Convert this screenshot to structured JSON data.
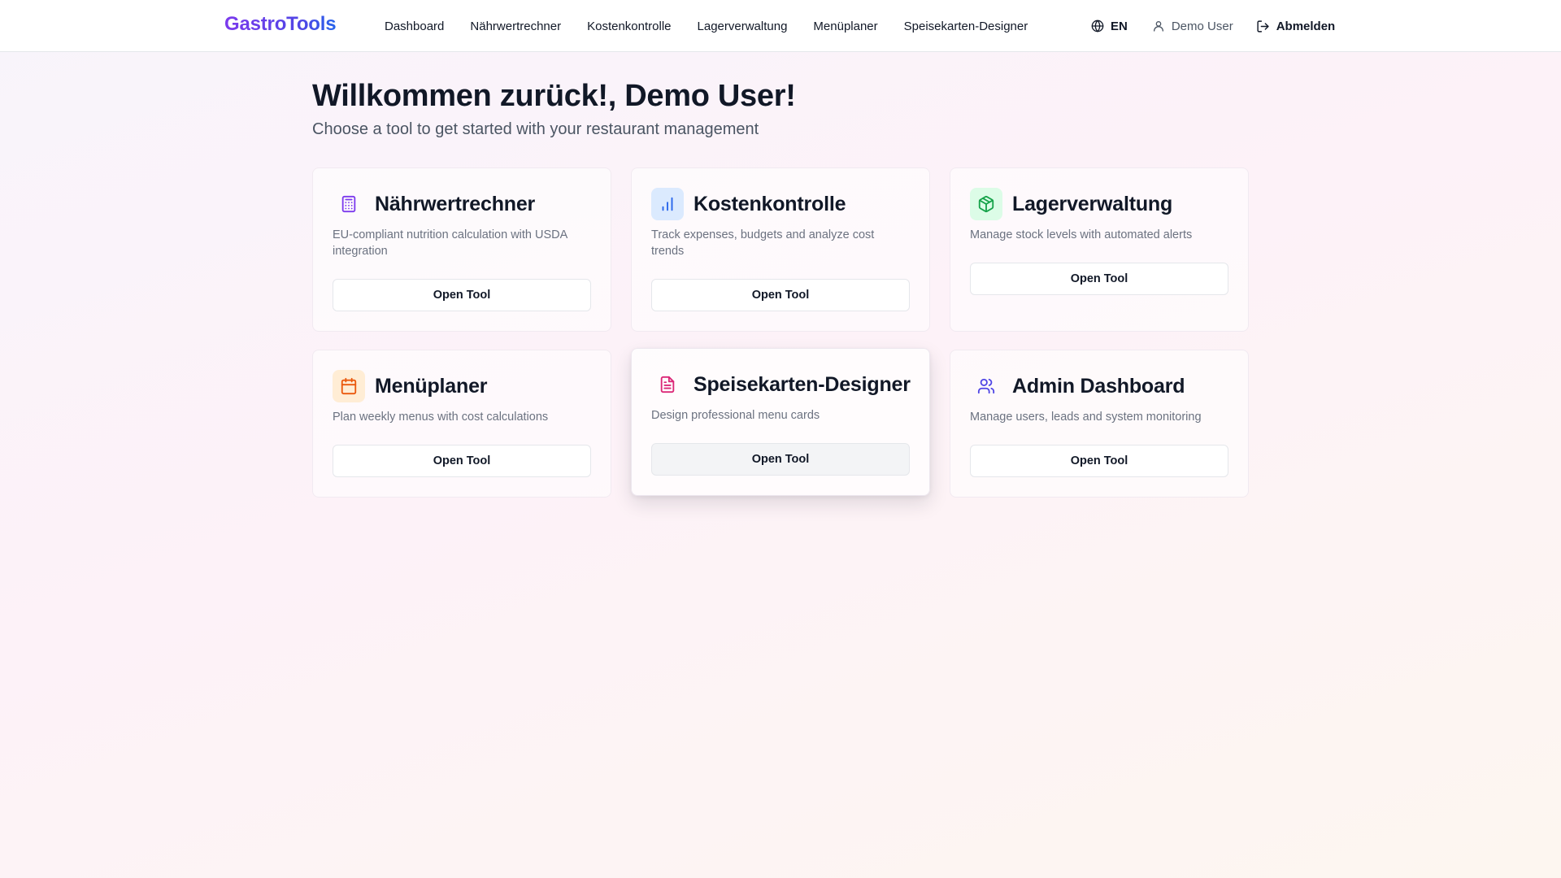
{
  "brand": "GastroTools",
  "nav": [
    "Dashboard",
    "Nährwertrechner",
    "Kostenkontrolle",
    "Lagerverwaltung",
    "Menüplaner",
    "Speisekarten-Designer"
  ],
  "header_right": {
    "language": "EN",
    "user_name": "Demo User",
    "logout_label": "Abmelden"
  },
  "welcome": {
    "title": "Willkommen zurück!, Demo User!",
    "subtitle": "Choose a tool to get started with your restaurant management"
  },
  "tools": [
    {
      "title": "Nährwertrechner",
      "description": "EU-compliant nutrition calculation with USDA integration",
      "button": "Open Tool",
      "icon": "calculator-icon",
      "color": "#7c3aed",
      "bg": "transparent"
    },
    {
      "title": "Kostenkontrolle",
      "description": "Track expenses, budgets and analyze cost trends",
      "button": "Open Tool",
      "icon": "bar-chart-icon",
      "color": "#2563eb",
      "bg": "#dbeafe"
    },
    {
      "title": "Lagerverwaltung",
      "description": "Manage stock levels with automated alerts",
      "button": "Open Tool",
      "icon": "package-icon",
      "color": "#16a34a",
      "bg": "#dcfce7"
    },
    {
      "title": "Menüplaner",
      "description": "Plan weekly menus with cost calculations",
      "button": "Open Tool",
      "icon": "calendar-icon",
      "color": "#ea580c",
      "bg": "#ffedd5"
    },
    {
      "title": "Speisekarten-Designer",
      "description": "Design professional menu cards",
      "button": "Open Tool",
      "icon": "file-text-icon",
      "color": "#db2777",
      "bg": "transparent"
    },
    {
      "title": "Admin Dashboard",
      "description": "Manage users, leads and system monitoring",
      "button": "Open Tool",
      "icon": "users-icon",
      "color": "#4f46e5",
      "bg": "transparent"
    }
  ]
}
